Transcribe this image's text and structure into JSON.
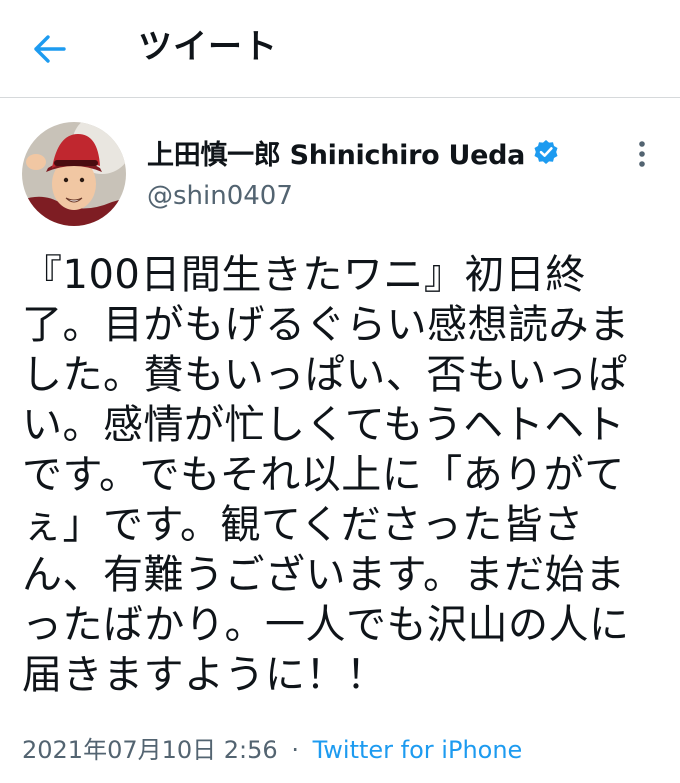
{
  "header": {
    "title": "ツイート",
    "back_icon": "arrow-left-icon"
  },
  "colors": {
    "accent": "#1d9bf0",
    "text": "#0f1419",
    "secondary": "#536471",
    "avatar_hat": "#b7262e"
  },
  "user": {
    "display_name": "上田慎一郎 Shinichiro Ueda",
    "handle": "@shin0407",
    "verified_icon": "verified-badge-icon",
    "more_icon": "more-vertical-icon"
  },
  "tweet": {
    "text": "『100日間生きたワニ』初日終\n了。目がもげるぐらい感想読みま\nした。賛もいっぱい、否もいっぱ\nい。感情が忙しくてもうヘトヘト\nです。でもそれ以上に「ありがて\nぇ」です。観てくださった皆さ\nん、有難うございます。まだ始ま\nったばかり。一人でも沢山の人に\n届きますように！！",
    "timestamp": "2021年07月10日 2:56",
    "separator": "·",
    "source": "Twitter for iPhone"
  }
}
